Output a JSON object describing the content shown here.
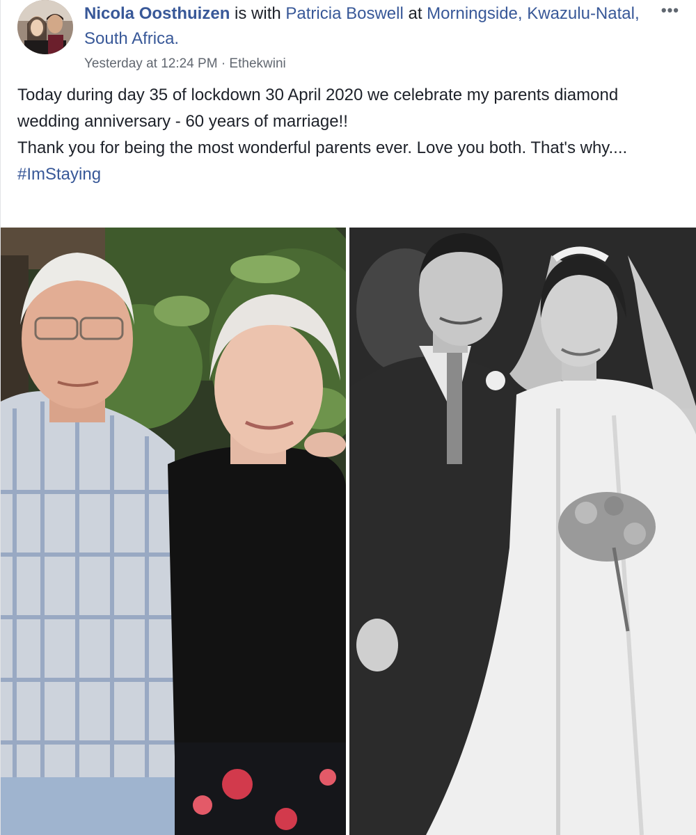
{
  "post": {
    "author": "Nicola Oosthuizen",
    "with_text": "is with",
    "tagged_friend": "Patricia Boswell",
    "at_text": "at",
    "location": "Morningside, Kwazulu-Natal, South Africa.",
    "timestamp": "Yesterday at 12:24 PM",
    "separator": "·",
    "place_tag": "Ethekwini",
    "more_icon": "more-horizontal-icon",
    "body_line_1": "Today during day 35 of lockdown 30 April 2020 we celebrate my parents diamond wedding anniversary - 60 years of marriage!!",
    "body_line_2": "Thank you for being the most wonderful parents ever. Love you both. That's why....",
    "hashtag": "#ImStaying"
  },
  "colors": {
    "link": "#385898",
    "text": "#1d2129",
    "meta": "#616770"
  }
}
